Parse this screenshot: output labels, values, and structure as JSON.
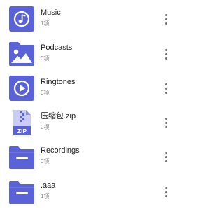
{
  "colors": {
    "icon_primary": "#5a62d8",
    "icon_light": "#ffffff",
    "zip_pale": "#c9ccf4",
    "name_text": "#212121",
    "meta_text": "#8a8a8a",
    "more_dots": "#6f6f6f"
  },
  "folders": [
    {
      "name": "Music",
      "count": "1项",
      "icon": "music-folder-icon"
    },
    {
      "name": "Podcasts",
      "count": "0项",
      "icon": "podcasts-folder-icon"
    },
    {
      "name": "Ringtones",
      "count": "0项",
      "icon": "ringtones-folder-icon"
    },
    {
      "name": "压缩包.zip",
      "count": "0项",
      "icon": "zip-file-icon"
    },
    {
      "name": "Recordings",
      "count": "0项",
      "icon": "recordings-folder-icon"
    },
    {
      "name": ".aaa",
      "count": "1项",
      "icon": "folder-icon"
    }
  ],
  "more_icon": "more-vertical-icon"
}
